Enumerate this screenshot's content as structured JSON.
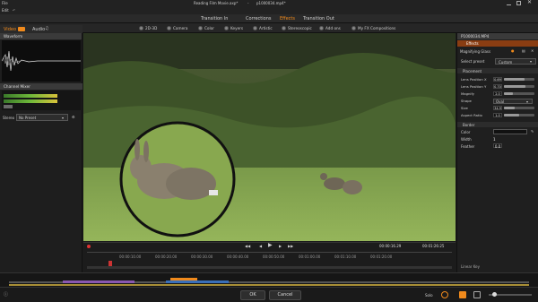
{
  "titlebar": {
    "project": "Reading Film Movie.axp*",
    "separator": "-",
    "file": "p1000034.mp4*"
  },
  "menu": {
    "file": "File",
    "edit": "Edit"
  },
  "main_tabs": [
    {
      "label": "Transition In"
    },
    {
      "label": "Corrections"
    },
    {
      "label": "Effects",
      "active": true
    },
    {
      "label": "Transition Out"
    }
  ],
  "categories": [
    "2D-3D",
    "Camera",
    "Color",
    "Keyers",
    "Artistic",
    "Stereoscopic",
    "Add ons",
    "My FX Compositions"
  ],
  "left": {
    "video_label": "Video",
    "audio_label": "Audio",
    "waveform_header": "Waveform",
    "channel_header": "Channel Mixer",
    "stereo_label": "Stereo",
    "preset_value": "No Preset"
  },
  "right": {
    "clip_name": "P1000034.MP4",
    "effects_label": "Effects",
    "effect_name": "Magnifying Glass",
    "select_preset_label": "Select preset",
    "select_preset_value": "Custom",
    "placement_header": "Placement",
    "rows": [
      {
        "label": "Lens Position X",
        "value": "0.69"
      },
      {
        "label": "Lens Position Y",
        "value": "0.70"
      },
      {
        "label": "Magnify",
        "value": "2.0"
      },
      {
        "label": "Shape",
        "value": "Oval"
      },
      {
        "label": "Size",
        "value": "34.9"
      },
      {
        "label": "Aspect Ratio",
        "value": "1.0"
      }
    ],
    "border_header": "Border",
    "color_label": "Color",
    "width_label": "Width",
    "width_value": "1",
    "feather_label": "Feather",
    "feather_value": "0.0",
    "linear_key": "Linear Key"
  },
  "timeline": {
    "timecode": "00:00:16.29",
    "end_timecode": "00:01:26:25",
    "ticks": [
      "00:00:10.00",
      "00:00:20.00",
      "00:00:30.00",
      "00:00:40.00",
      "00:00:50.00",
      "00:01:00.00",
      "00:01:10.00",
      "00:01:20.00"
    ]
  },
  "footer": {
    "ok": "OK",
    "cancel": "Cancel",
    "solo": "Solo"
  },
  "colors": {
    "accent": "#f08a1c",
    "panel": "#1e1e1e",
    "header": "#3a3a3a"
  },
  "icons": [
    "close-icon",
    "undo-icon",
    "play-icon",
    "stop-icon",
    "rewind-icon",
    "forward-icon",
    "gear-icon",
    "info-icon",
    "music-note-icon",
    "camera-icon"
  ]
}
